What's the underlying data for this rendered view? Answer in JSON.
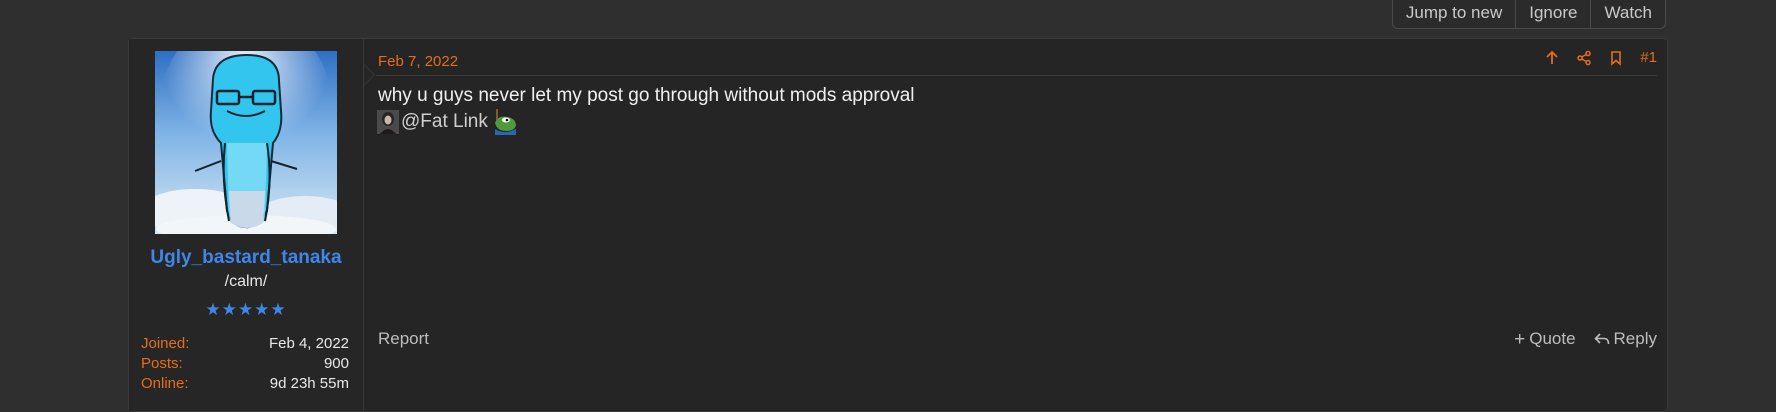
{
  "thread_controls": {
    "jump_to_new": "Jump to new",
    "ignore": "Ignore",
    "watch": "Watch"
  },
  "user": {
    "name": "Ugly_bastard_tanaka",
    "title": "/calm/",
    "stars": "★★★★★",
    "stats": [
      {
        "key": "Joined:",
        "value": "Feb 4, 2022"
      },
      {
        "key": "Posts:",
        "value": "900"
      },
      {
        "key": "Online:",
        "value": "9d 23h 55m"
      }
    ]
  },
  "post": {
    "date": "Feb 7, 2022",
    "number": "#1",
    "body": "why u guys never let my post go through without mods approval",
    "mention": "@Fat Link"
  },
  "footer": {
    "report": "Report",
    "quote": "Quote",
    "reply": "Reply"
  },
  "colors": {
    "accent_orange": "#e56d1b",
    "link_blue": "#3f86e8",
    "page_bg": "#2f2f2f",
    "post_bg": "#252525"
  }
}
